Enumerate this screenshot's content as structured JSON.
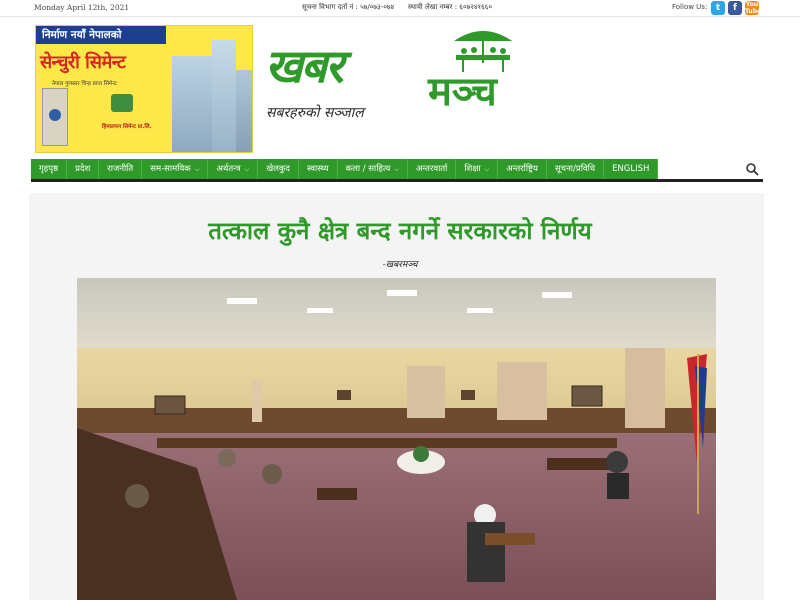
{
  "topbar": {
    "date": "Monday April 12th, 2021",
    "registration": "सूचना विभाग दर्ता नं : ५७/०७३-०७४",
    "pan": "स्थायी लेखा नम्बर : ६०७२४१६६०",
    "follow_label": "Follow Us:",
    "social": [
      {
        "name": "twitter-icon",
        "glyph": "t",
        "color": "#2ea5e6"
      },
      {
        "name": "facebook-icon",
        "glyph": "f",
        "color": "#3b5998"
      },
      {
        "name": "youtube-icon",
        "glyph": "You Tube",
        "color": "#f08b1e"
      }
    ]
  },
  "ad": {
    "tagline": "निर्माण नयाँ नेपालको",
    "brand": "सेन्चुरी सिमेन्ट",
    "sub": "नेपाल गुणस्तर चिन्ह प्राप्त सिमेन्ट",
    "company": "हिमालयन सिमेन्ट प्रा.लि."
  },
  "logo": {
    "part1": "खबर",
    "part2": "मञ्च",
    "slogan": "सबरहरुको सञ्जाल"
  },
  "nav": {
    "items": [
      {
        "label": "गृहपृष्ठ",
        "has_dropdown": false
      },
      {
        "label": "प्रदेश",
        "has_dropdown": false
      },
      {
        "label": "राजनीति",
        "has_dropdown": false
      },
      {
        "label": "सम-सामयिक",
        "has_dropdown": true
      },
      {
        "label": "अर्थतन्त्र",
        "has_dropdown": true
      },
      {
        "label": "खेलकुद",
        "has_dropdown": false
      },
      {
        "label": "स्वास्थ्य",
        "has_dropdown": false
      },
      {
        "label": "कला / साहित्य",
        "has_dropdown": true
      },
      {
        "label": "अन्तरवार्ता",
        "has_dropdown": false
      },
      {
        "label": "शिक्षा",
        "has_dropdown": true
      },
      {
        "label": "अन्तर्राष्ट्रिय",
        "has_dropdown": false
      },
      {
        "label": "सूचना/प्रविधि",
        "has_dropdown": false
      },
      {
        "label": "ENGLISH",
        "has_dropdown": false
      }
    ],
    "search_icon": "search-icon",
    "accent": "#2f9a2a"
  },
  "article": {
    "headline": "तत्काल कुनै क्षेत्र बन्द नगर्ने सरकारको निर्णय",
    "byline": "-खबरमञ्च"
  }
}
